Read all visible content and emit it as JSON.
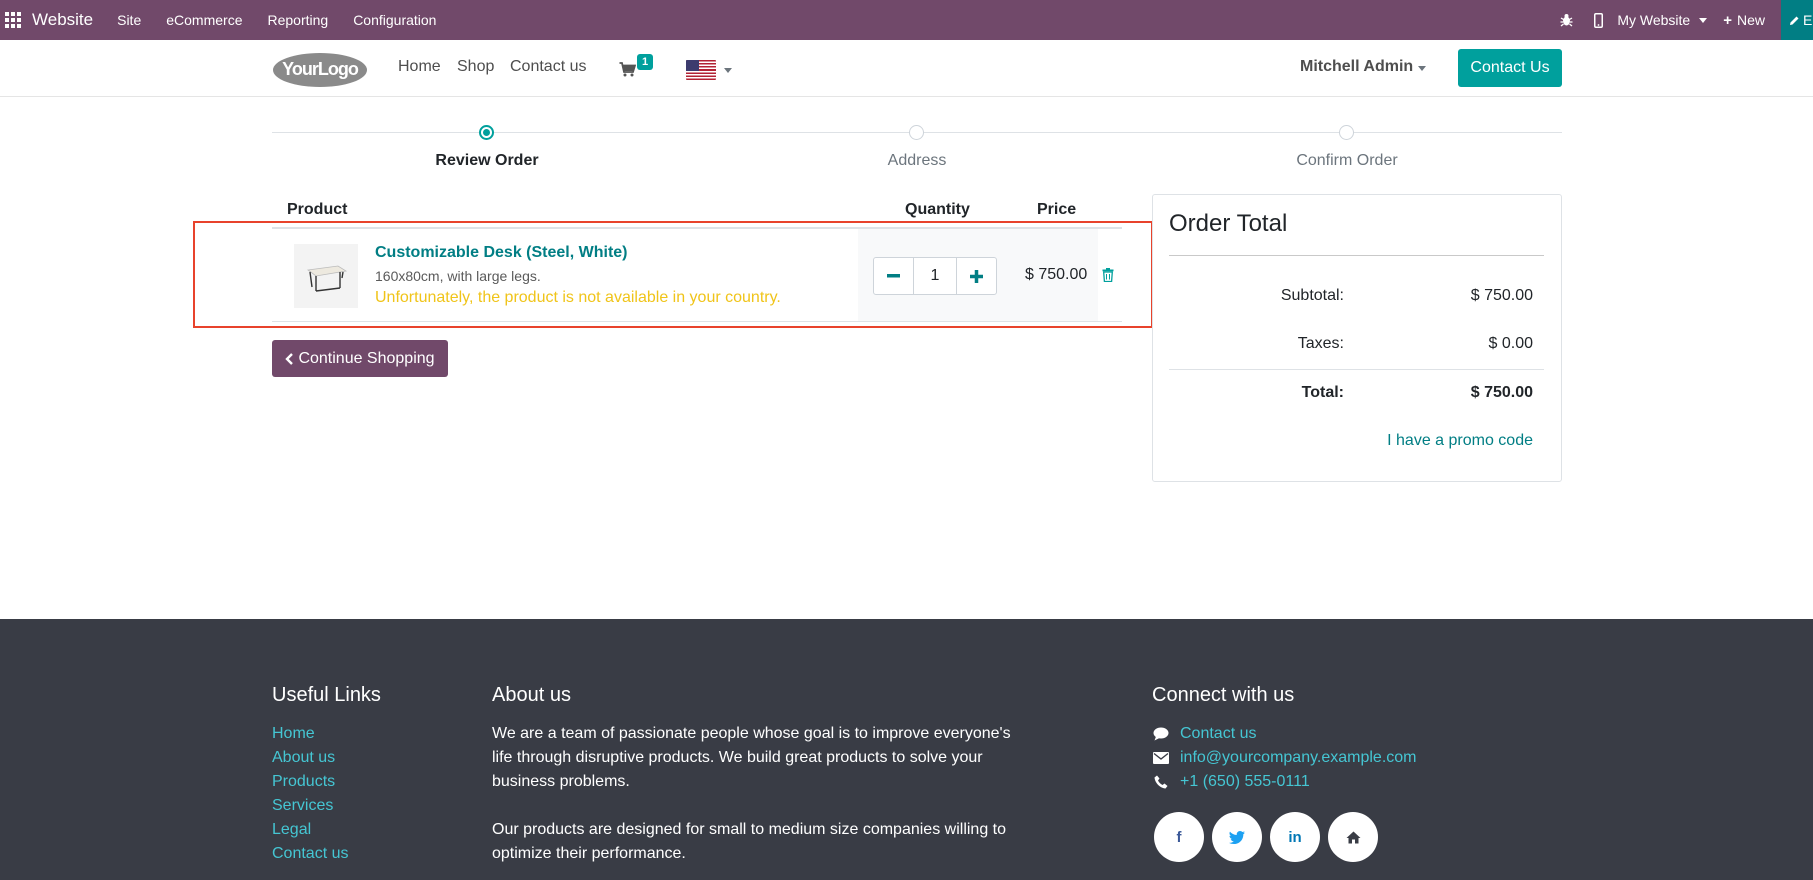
{
  "topbar": {
    "app_name": "Website",
    "menus": [
      "Site",
      "eCommerce",
      "Reporting",
      "Configuration"
    ],
    "website_switcher": "My Website",
    "new_label": "New",
    "edit_label": "E",
    "bg_color": "#71496a"
  },
  "header": {
    "logo_text": "YourLogo",
    "nav": [
      "Home",
      "Shop",
      "Contact us"
    ],
    "cart_count": "1",
    "language_flag": "us-flag-icon",
    "user_name": "Mitchell Admin",
    "contact_button": "Contact Us"
  },
  "wizard": {
    "steps": [
      {
        "label": "Review Order",
        "active": true
      },
      {
        "label": "Address",
        "active": false
      },
      {
        "label": "Confirm Order",
        "active": false
      }
    ]
  },
  "cart": {
    "columns": {
      "product": "Product",
      "quantity": "Quantity",
      "price": "Price"
    },
    "lines": [
      {
        "name": "Customizable Desk (Steel, White)",
        "description": "160x80cm, with large legs.",
        "warning": "Unfortunately, the product is not available in your country.",
        "quantity": "1",
        "price": "$ 750.00"
      }
    ],
    "continue_label": "Continue Shopping"
  },
  "order_total": {
    "title": "Order Total",
    "subtotal_label": "Subtotal:",
    "subtotal_value": "$ 750.00",
    "taxes_label": "Taxes:",
    "taxes_value": "$ 0.00",
    "total_label": "Total:",
    "total_value": "$ 750.00",
    "promo_label": "I have a promo code"
  },
  "footer": {
    "useful_links_title": "Useful Links",
    "useful_links": [
      "Home",
      "About us",
      "Products",
      "Services",
      "Legal",
      "Contact us"
    ],
    "about_title": "About us",
    "about_p1_line1": "We are a team of passionate people whose goal is to improve everyone's",
    "about_p1_line2": "life through disruptive products. We build great products to solve your",
    "about_p1_line3": "business problems.",
    "about_p2_line1": "Our products are designed for small to medium size companies willing to",
    "about_p2_line2": "optimize their performance.",
    "connect_title": "Connect with us",
    "contact_link": "Contact us",
    "email": "info@yourcompany.example.com",
    "phone": "+1 (650) 555-0111",
    "social": [
      "f",
      "t",
      "in",
      "home"
    ]
  },
  "colors": {
    "accent": "#00a09d",
    "link": "#017e84",
    "warning": "#f0c419",
    "highlight_box": "#e8432c",
    "footer_bg": "#393c45",
    "footer_link": "#45c6d3"
  }
}
